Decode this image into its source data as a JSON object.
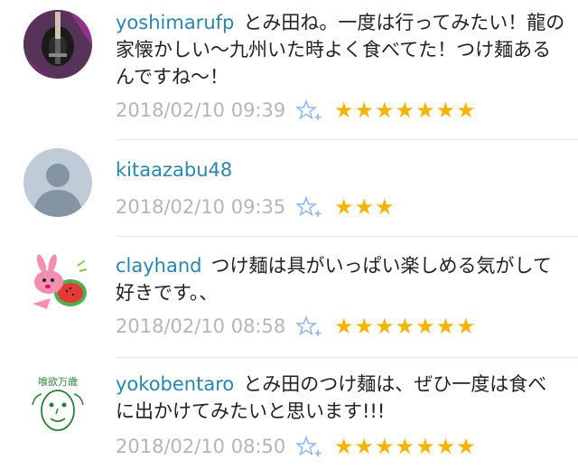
{
  "comments": [
    {
      "username": "yoshimarufp",
      "text": "とみ田ね。一度は行ってみたい！龍の家懐かしい〜九州いた時よく食べてた！つけ麺あるんですね〜！",
      "timestamp": "2018/02/10 09:39",
      "stars_display": "★★★★★★★",
      "star_count": 7,
      "avatar": "guitar-photo"
    },
    {
      "username": "kitaazabu48",
      "text": "",
      "timestamp": "2018/02/10 09:35",
      "stars_display": "★★★",
      "star_count": 3,
      "avatar": "default-person"
    },
    {
      "username": "clayhand",
      "text": "つけ麺は具がいっぱい楽しめる気がして好きです。、",
      "timestamp": "2018/02/10 08:58",
      "stars_display": "★★★★★★★",
      "star_count": 7,
      "avatar": "pink-rabbit-watermelon"
    },
    {
      "username": "yokobentaro",
      "text": "とみ田のつけ麺は、ぜひ一度は食べに出かけてみたいと思います!!!",
      "timestamp": "2018/02/10 08:50",
      "stars_display": "★★★★★★★",
      "star_count": 7,
      "avatar": "face-sketch",
      "avatar_text": "喰欲万歳"
    }
  ],
  "colors": {
    "username": "#2a86a8",
    "timestamp": "#b5b5b5",
    "star": "#f5b400",
    "star_add": "#8fb5e6"
  }
}
